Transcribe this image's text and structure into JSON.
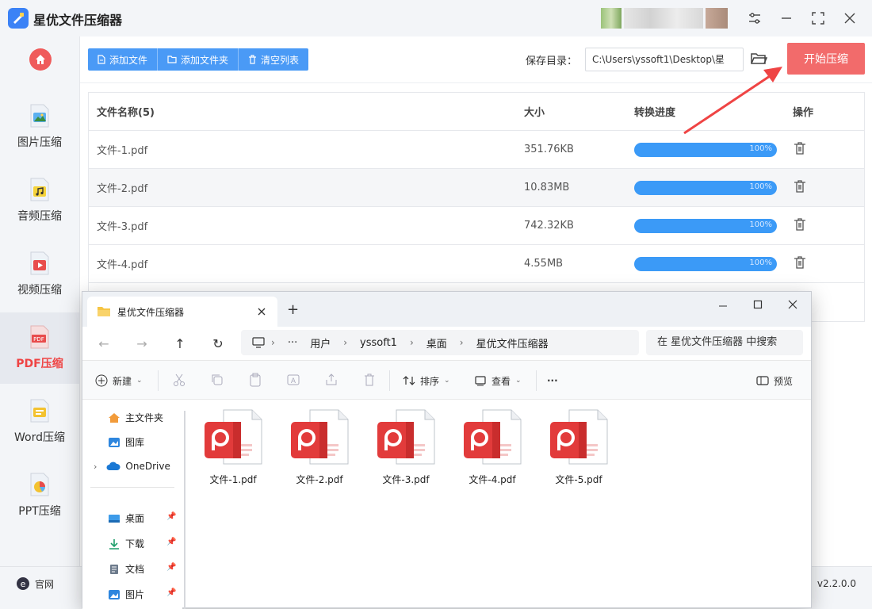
{
  "app": {
    "title": "星优文件压缩器",
    "version": "v2.2.0.0",
    "official_label": "官网"
  },
  "sidebar": {
    "items": [
      {
        "label": "图片压缩",
        "icon": "image-compress-icon",
        "active": false
      },
      {
        "label": "音频压缩",
        "icon": "audio-compress-icon",
        "active": false
      },
      {
        "label": "视频压缩",
        "icon": "video-compress-icon",
        "active": false
      },
      {
        "label": "PDF压缩",
        "icon": "pdf-compress-icon",
        "active": true
      },
      {
        "label": "Word压缩",
        "icon": "word-compress-icon",
        "active": false
      },
      {
        "label": "PPT压缩",
        "icon": "ppt-compress-icon",
        "active": false
      }
    ]
  },
  "toolbar": {
    "add_file": "添加文件",
    "add_folder": "添加文件夹",
    "clear_list": "清空列表"
  },
  "save": {
    "label": "保存目录：",
    "path": "C:\\Users\\yssoft1\\Desktop\\星"
  },
  "start_button": "开始压缩",
  "table": {
    "headers": {
      "name": "文件名称(5)",
      "size": "大小",
      "progress": "转换进度",
      "action": "操作"
    },
    "rows": [
      {
        "name": "文件-1.pdf",
        "size": "351.76KB",
        "progress": "100%"
      },
      {
        "name": "文件-2.pdf",
        "size": "10.83MB",
        "progress": "100%"
      },
      {
        "name": "文件-3.pdf",
        "size": "742.32KB",
        "progress": "100%"
      },
      {
        "name": "文件-4.pdf",
        "size": "4.55MB",
        "progress": "100%"
      }
    ]
  },
  "explorer": {
    "tab_title": "星优文件压缩器",
    "breadcrumb": [
      "用户",
      "yssoft1",
      "桌面",
      "星优文件压缩器"
    ],
    "search_placeholder": "在 星优文件压缩器 中搜索",
    "commands": {
      "new": "新建",
      "sort": "排序",
      "view": "查看",
      "more": "···",
      "preview": "预览"
    },
    "sidebar": {
      "home": "主文件夹",
      "gallery": "图库",
      "onedrive": "OneDrive",
      "desktop": "桌面",
      "downloads": "下载",
      "documents": "文档",
      "pictures": "图片"
    },
    "files": [
      "文件-1.pdf",
      "文件-2.pdf",
      "文件-3.pdf",
      "文件-4.pdf",
      "文件-5.pdf"
    ]
  },
  "colors": {
    "accent": "#4a9af6",
    "start": "#f26b6b",
    "active": "#ef4444",
    "progress": "#3b9af7",
    "pdf": "#e23b3b"
  }
}
